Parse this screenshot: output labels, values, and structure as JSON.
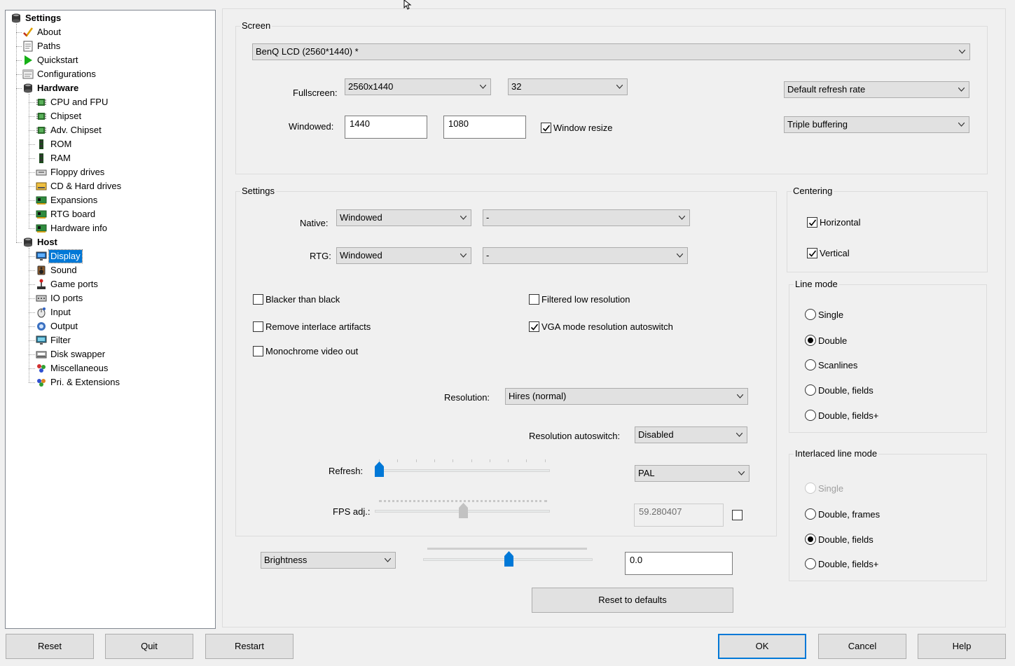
{
  "tree": {
    "items": [
      {
        "label": "Settings",
        "icon": "settings-root-icon"
      },
      {
        "label": "About",
        "icon": "about-checkmark-icon"
      },
      {
        "label": "Paths",
        "icon": "paths-icon"
      },
      {
        "label": "Quickstart",
        "icon": "quickstart-play-icon"
      },
      {
        "label": "Configurations",
        "icon": "configurations-icon"
      },
      {
        "label": "Hardware",
        "icon": "hardware-icon"
      },
      {
        "label": "CPU and FPU",
        "icon": "chip-icon"
      },
      {
        "label": "Chipset",
        "icon": "chip-icon"
      },
      {
        "label": "Adv. Chipset",
        "icon": "chip-icon"
      },
      {
        "label": "ROM",
        "icon": "memory-icon"
      },
      {
        "label": "RAM",
        "icon": "memory-icon"
      },
      {
        "label": "Floppy drives",
        "icon": "floppy-drive-icon"
      },
      {
        "label": "CD & Hard drives",
        "icon": "hard-drive-icon"
      },
      {
        "label": "Expansions",
        "icon": "expansion-card-icon"
      },
      {
        "label": "RTG board",
        "icon": "expansion-card-icon"
      },
      {
        "label": "Hardware info",
        "icon": "expansion-card-icon"
      },
      {
        "label": "Host",
        "icon": "host-icon"
      },
      {
        "label": "Display",
        "icon": "monitor-icon"
      },
      {
        "label": "Sound",
        "icon": "speaker-icon"
      },
      {
        "label": "Game ports",
        "icon": "joystick-icon"
      },
      {
        "label": "IO ports",
        "icon": "io-port-icon"
      },
      {
        "label": "Input",
        "icon": "mouse-icon"
      },
      {
        "label": "Output",
        "icon": "output-icon"
      },
      {
        "label": "Filter",
        "icon": "filter-monitor-icon"
      },
      {
        "label": "Disk swapper",
        "icon": "disk-swapper-icon"
      },
      {
        "label": "Miscellaneous",
        "icon": "misc-icon"
      },
      {
        "label": "Pri. & Extensions",
        "icon": "extensions-icon"
      }
    ]
  },
  "screen": {
    "title": "Screen",
    "monitor": "BenQ LCD (2560*1440) *",
    "fullscreen_label": "Fullscreen:",
    "fullscreen_res": "2560x1440",
    "fullscreen_depth": "32",
    "refresh_rate": "Default refresh rate",
    "windowed_label": "Windowed:",
    "windowed_width": "1440",
    "windowed_height": "1080",
    "window_resize_label": "Window resize",
    "window_resize_checked": true,
    "buffering": "Triple buffering"
  },
  "settings": {
    "title": "Settings",
    "native_label": "Native:",
    "native_mode": "Windowed",
    "native_option": "-",
    "rtg_label": "RTG:",
    "rtg_mode": "Windowed",
    "rtg_option": "-",
    "checkboxes": [
      {
        "label": "Blacker than black",
        "checked": false
      },
      {
        "label": "Filtered low resolution",
        "checked": false
      },
      {
        "label": "Remove interlace artifacts",
        "checked": false
      },
      {
        "label": "VGA mode resolution autoswitch",
        "checked": true
      },
      {
        "label": "Monochrome video out",
        "checked": false
      }
    ],
    "resolution_label": "Resolution:",
    "resolution": "Hires (normal)",
    "autoswitch_label": "Resolution autoswitch:",
    "autoswitch": "Disabled",
    "refresh_label": "Refresh:",
    "refresh_slider_fraction": 0.0,
    "video_standard": "PAL",
    "fps_label": "FPS adj.:",
    "fps_slider_fraction": 0.5,
    "fps_value": "59.280407",
    "fps_checked": false
  },
  "adjust": {
    "mode": "Brightness",
    "slider_fraction": 0.5,
    "value": "0.0",
    "reset_label": "Reset to defaults"
  },
  "centering": {
    "title": "Centering",
    "horizontal_label": "Horizontal",
    "horizontal_checked": true,
    "vertical_label": "Vertical",
    "vertical_checked": true
  },
  "line_mode": {
    "title": "Line mode",
    "options": [
      "Single",
      "Double",
      "Scanlines",
      "Double, fields",
      "Double, fields+"
    ],
    "selected": "Double"
  },
  "interlaced_line_mode": {
    "title": "Interlaced line mode",
    "options": [
      "Single",
      "Double, frames",
      "Double, fields",
      "Double, fields+"
    ],
    "selected": "Double, fields",
    "disabled": [
      "Single"
    ]
  },
  "buttons": {
    "reset": "Reset",
    "quit": "Quit",
    "restart": "Restart",
    "ok": "OK",
    "cancel": "Cancel",
    "help": "Help"
  },
  "colors": {
    "accent": "#0078d7",
    "window_bg": "#f0f0f0",
    "button_bg": "#e1e1e1"
  }
}
